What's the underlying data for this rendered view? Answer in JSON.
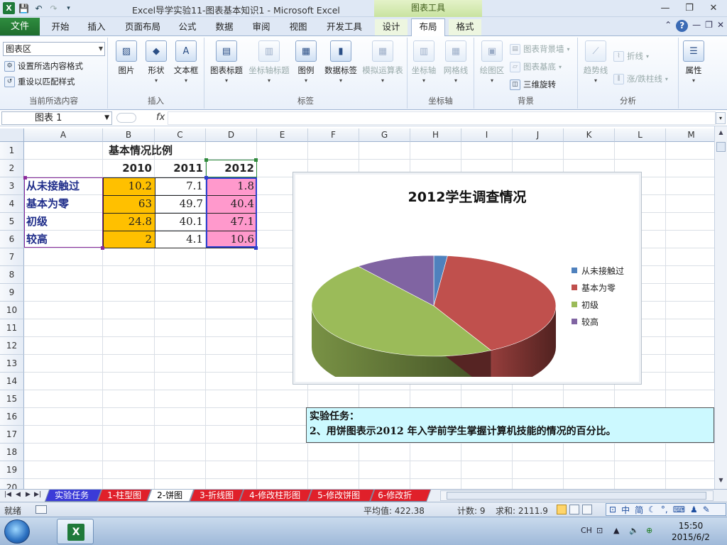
{
  "titlebar": {
    "title": "Excel导学实验11-图表基本知识1  -  Microsoft Excel",
    "chart_tools": "图表工具",
    "minimize": "—",
    "restore": "❐",
    "close": "✕"
  },
  "tabs": {
    "file": "文件",
    "items": [
      "开始",
      "插入",
      "页面布局",
      "公式",
      "数据",
      "审阅",
      "视图",
      "开发工具",
      "设计",
      "布局",
      "格式"
    ],
    "active": "布局"
  },
  "ribbon": {
    "element_selector": "图表区",
    "current_selection": {
      "format_selection": "设置所选内容格式",
      "reset_style": "重设以匹配样式",
      "label": "当前所选内容"
    },
    "insert": {
      "picture": "图片",
      "shapes": "形状",
      "textbox": "文本框",
      "label": "插入"
    },
    "labels": {
      "chart_title": "图表标题",
      "axis_title": "坐标轴标题",
      "legend": "图例",
      "data_labels": "数据标签",
      "data_table": "模拟运算表",
      "label": "标签"
    },
    "axes": {
      "axes": "坐标轴",
      "gridlines": "网格线",
      "label": "坐标轴"
    },
    "background": {
      "plot_area": "绘图区",
      "chart_wall": "图表背景墙",
      "chart_floor": "图表基底",
      "rotation": "三维旋转",
      "label": "背景"
    },
    "analysis": {
      "trendline": "趋势线",
      "lines": "折线",
      "updown_bars": "涨/跌柱线",
      "label": "分析"
    },
    "properties": {
      "properties": "属性"
    }
  },
  "formula_bar": {
    "name_box": "图表 1",
    "fx": "fx",
    "value": ""
  },
  "grid": {
    "columns": [
      "A",
      "B",
      "C",
      "D",
      "E",
      "F",
      "G",
      "H",
      "I",
      "J",
      "K",
      "L",
      "M"
    ],
    "rows": [
      "1",
      "2",
      "3",
      "4",
      "5",
      "6",
      "7",
      "8",
      "9",
      "10",
      "11",
      "12",
      "13",
      "14",
      "15",
      "16",
      "17",
      "18",
      "19",
      "20"
    ],
    "title": "基本情况比例",
    "years": [
      "2010",
      "2011",
      "2012"
    ],
    "table": [
      {
        "label": "从未接触过",
        "v2010": "10.2",
        "v2011": "7.1",
        "v2012": "1.8"
      },
      {
        "label": "基本为零",
        "v2010": "63",
        "v2011": "49.7",
        "v2012": "40.4"
      },
      {
        "label": "初级",
        "v2010": "24.8",
        "v2011": "40.1",
        "v2012": "47.1"
      },
      {
        "label": "较高",
        "v2010": "2",
        "v2011": "4.1",
        "v2012": "10.6"
      }
    ],
    "colors": {
      "col2010": "#ffc000",
      "col2012": "#ff99cc",
      "label_text": "#1f2d8a"
    }
  },
  "chart_data": {
    "type": "pie",
    "title": "2012学生调查情况",
    "categories": [
      "从未接触过",
      "基本为零",
      "初级",
      "较高"
    ],
    "values": [
      1.8,
      40.4,
      47.1,
      10.6
    ],
    "colors": [
      "#4f81bd",
      "#c0504d",
      "#9bbb59",
      "#8064a2"
    ],
    "legend": "right",
    "three_d": true
  },
  "task": {
    "heading": "实验任务：",
    "text": "2、用饼图表示2012 年入学前学生掌握计算机技能的情况的百分比。"
  },
  "sheets": {
    "tabs": [
      {
        "name": "实验任务",
        "color": "#3b3bd8",
        "text": "#fff"
      },
      {
        "name": "1-柱型图",
        "color": "#e0202a",
        "text": "#fff"
      },
      {
        "name": "2-饼图",
        "color": "#ffffff",
        "text": "#000"
      },
      {
        "name": "3-折线图",
        "color": "#e0202a",
        "text": "#fff"
      },
      {
        "name": "4-修改柱形图",
        "color": "#e0202a",
        "text": "#fff"
      },
      {
        "name": "5-修改饼图",
        "color": "#e0202a",
        "text": "#fff"
      },
      {
        "name": "6-修改折线",
        "color": "#e0202a",
        "text": "#fff"
      }
    ],
    "active": "2-饼图"
  },
  "statusbar": {
    "ready": "就绪",
    "average": "平均值: 422.38",
    "count": "计数: 9",
    "sum": "求和: 2111.9",
    "ime": [
      "中",
      "简"
    ]
  },
  "taskbar": {
    "lang": "CH",
    "time": "15:50",
    "date": "2015/6/2"
  }
}
